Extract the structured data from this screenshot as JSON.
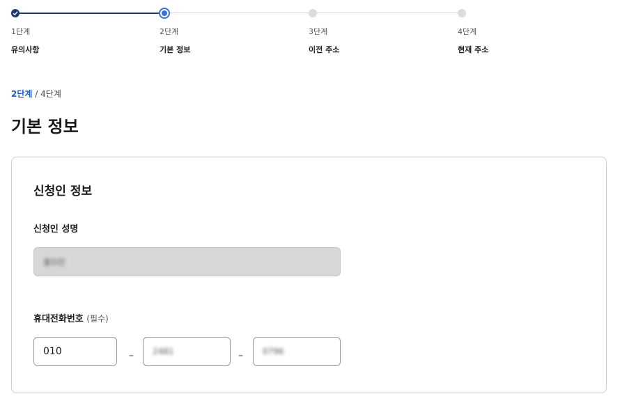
{
  "stepper": {
    "steps": [
      {
        "num": "1단계",
        "name": "유의사항",
        "state": "done"
      },
      {
        "num": "2단계",
        "name": "기본 정보",
        "state": "current"
      },
      {
        "num": "3단계",
        "name": "이전 주소",
        "state": "todo"
      },
      {
        "num": "4단계",
        "name": "현재 주소",
        "state": "todo"
      }
    ]
  },
  "progress": {
    "current": "2단계",
    "separator": "/",
    "total": "4단계"
  },
  "page_title": "기본 정보",
  "applicant": {
    "section_title": "신청인 정보",
    "name_label": "신청인 성명",
    "name_value": "홍O진",
    "phone_label": "휴대전화번호",
    "phone_required": "(필수)",
    "phone_part1": "010",
    "phone_part2": "2481",
    "phone_part3": "0796",
    "dash": "–"
  },
  "colors": {
    "accent": "#3b6fd8",
    "done": "#1e3a6d",
    "progress_text": "#1f5bb8"
  }
}
